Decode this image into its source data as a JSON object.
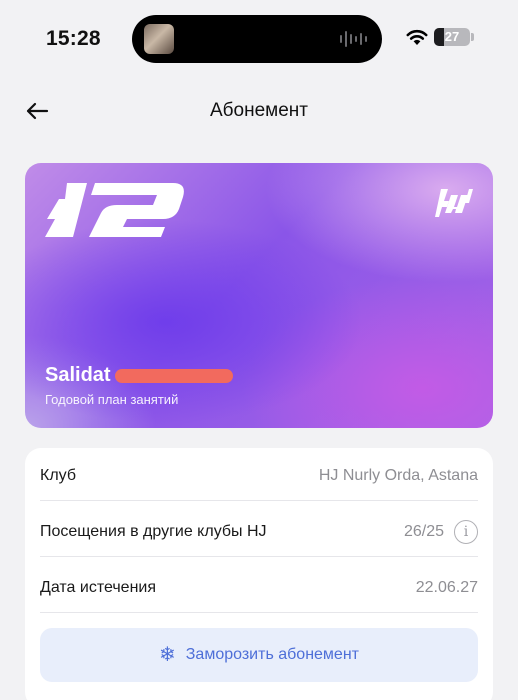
{
  "status_bar": {
    "time": "15:28",
    "battery_level": "27",
    "battery_fraction": 0.27
  },
  "nav": {
    "back_icon": "arrow-left-icon",
    "title": "Абонемент"
  },
  "card": {
    "logo_icon": "12-logo-icon",
    "brand_icon": "hj-brand-icon",
    "holder_name": "Salidat",
    "plan": "Годовой план занятий",
    "colors": {
      "primary": "#8a55e8",
      "secondary": "#c08ce8",
      "redaction": "#f26a5e"
    }
  },
  "details": {
    "rows": [
      {
        "label": "Клуб",
        "value": "HJ Nurly Orda, Astana"
      },
      {
        "label": "Посещения в другие клубы HJ",
        "value": "26/25",
        "icon": "info-icon"
      },
      {
        "label": "Дата истечения",
        "value": "22.06.27"
      }
    ],
    "freeze_button": {
      "icon": "snowflake-icon",
      "label": "Заморозить абонемент",
      "color": "#4e6fd8"
    }
  }
}
